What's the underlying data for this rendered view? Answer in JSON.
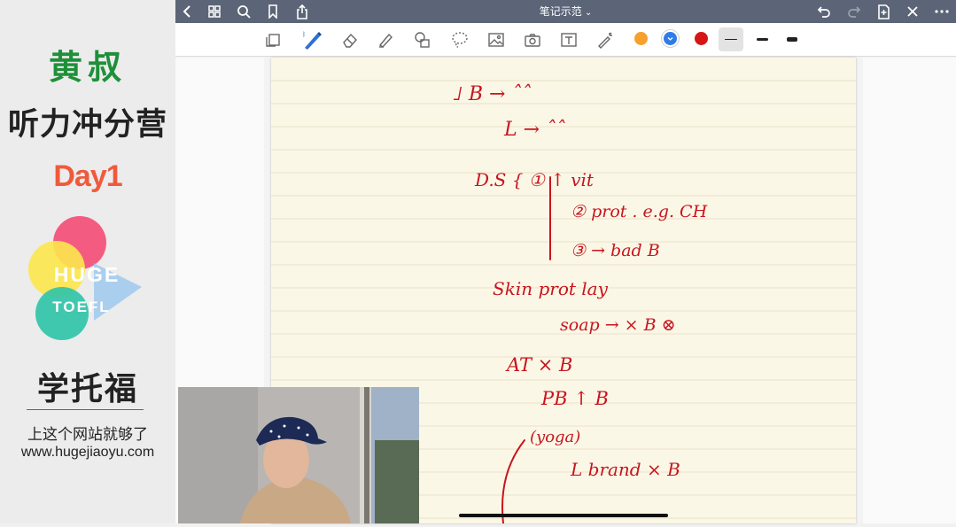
{
  "promo": {
    "brand": "黄叔",
    "course_title": "听力冲分营",
    "day": "Day1",
    "logo_line1": "HUGE",
    "logo_line2": "TOEFL",
    "school": "学托福",
    "slogan": "上这个网站就够了",
    "url": "www.hugejiaoyu.com"
  },
  "navbar": {
    "title": "笔记示范",
    "icons": [
      "back-icon",
      "grid-icon",
      "search-icon",
      "bookmark-icon",
      "share-icon",
      "undo-icon",
      "redo-icon",
      "add-page-icon",
      "close-icon",
      "more-icon"
    ]
  },
  "toolbar": {
    "tools": [
      "page-icon",
      "pen-icon",
      "eraser-icon",
      "highlighter-icon",
      "shapes-icon",
      "lasso-icon",
      "image-icon",
      "camera-icon",
      "text-icon",
      "laser-icon"
    ],
    "colors": [
      "#f5a12c",
      "#2f7be8",
      "#d61616"
    ]
  },
  "notes": {
    "ink_color": "#c8141e",
    "lines": [
      "˩ B → ˆˆ",
      "L → ˆˆ",
      "D.S { ① ↑ vit",
      "② prot . e.g. CH",
      "③ → bad B",
      "Skin prot lay",
      "soap → × B ⊗",
      "AT × B",
      "PB ↑ B",
      "(yoga)",
      "L brand × B"
    ]
  }
}
